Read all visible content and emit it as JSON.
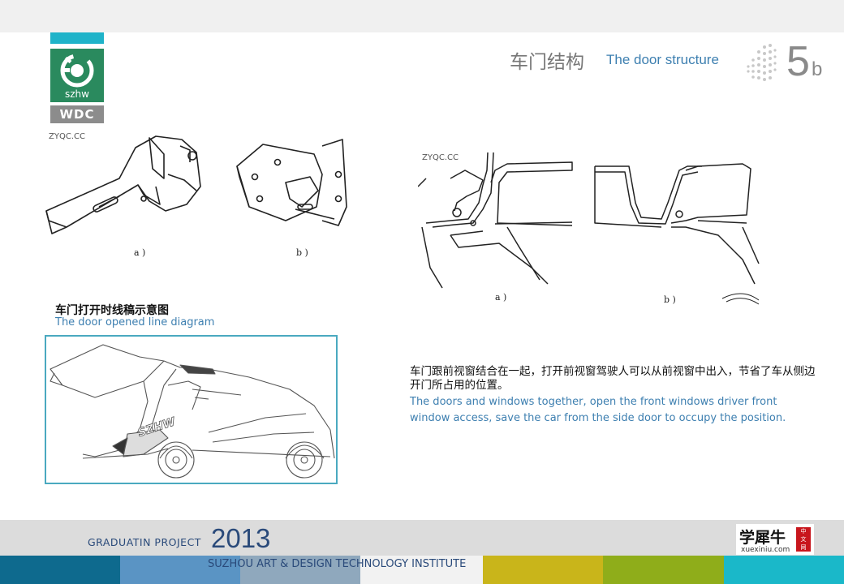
{
  "header": {
    "title_cn": "车门结构",
    "title_en": "The door structure",
    "page_number": "5",
    "page_suffix": "b"
  },
  "logo": {
    "text": "szhw",
    "subtext": "WDC"
  },
  "watermarks": {
    "left": "ZYQC.CC",
    "right": "ZYQC.CC"
  },
  "hinge_diagram": {
    "label_a": "a )",
    "label_b": "b )"
  },
  "section_diagram": {
    "label_a": "a )",
    "label_b": "b )"
  },
  "car_section": {
    "title_cn": "车门打开时线稿示意图",
    "title_en": "The door opened line diagram",
    "car_text": "SZHW"
  },
  "description": {
    "cn": "车门跟前视窗结合在一起，打开前视窗驾驶人可以从前视窗中出入，节省了车从侧边开门所占用的位置。",
    "en": "The doors and windows together, open the front windows driver front window access, save the car from the side door to occupy the position."
  },
  "footer": {
    "project": "GRADUATIN  PROJECT",
    "year": "2013",
    "institute": "SUZHOU ART & DESIGN TECHNOLOGY INSTITUTE",
    "logo_text": "学犀牛",
    "logo_url": "xuexiniu.com",
    "logo_tag": "中文网",
    "stripe_colors": [
      "#0e6a8e",
      "#5a94c4",
      "#8fa8bd",
      "#f2f2f2",
      "#c9b51a",
      "#8fad1a",
      "#1ab8c9"
    ]
  }
}
